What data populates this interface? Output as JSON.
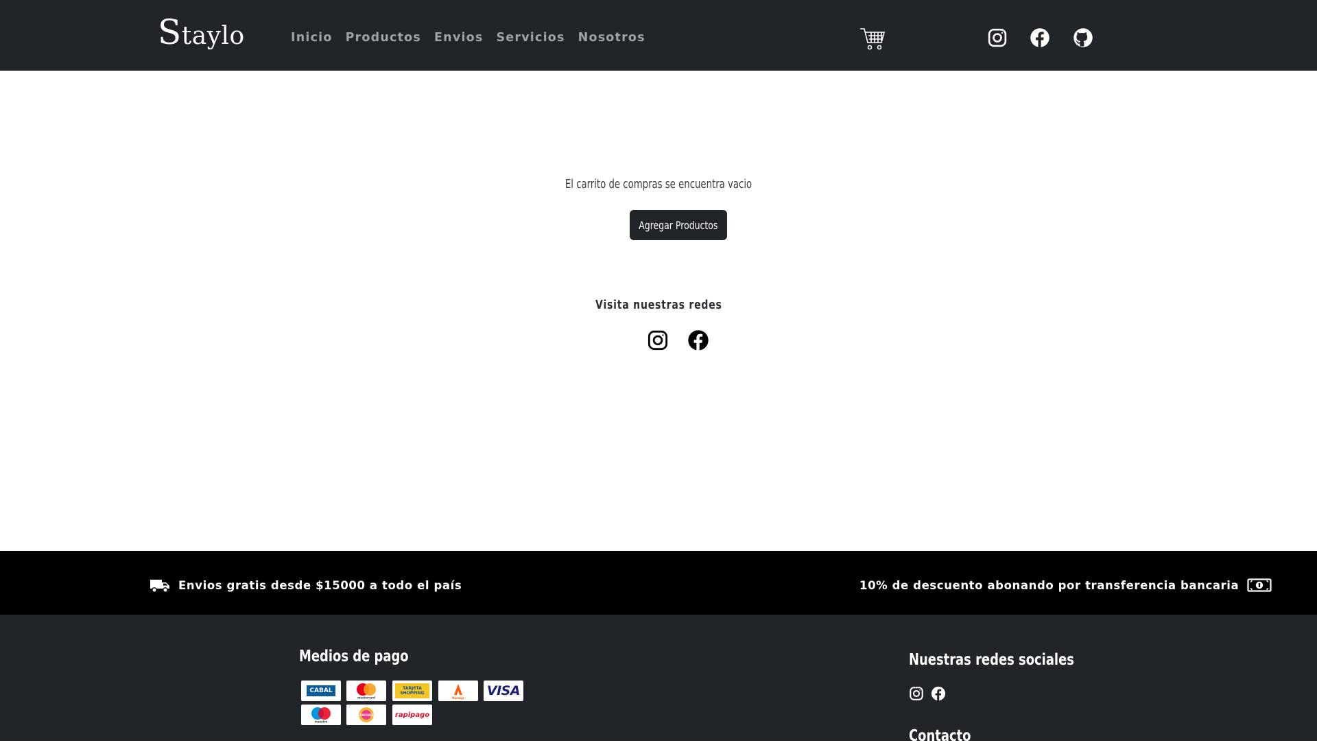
{
  "brand": {
    "first": "S",
    "rest": "taylo"
  },
  "nav": {
    "links": [
      "Inicio",
      "Productos",
      "Envios",
      "Servicios",
      "Nosotros"
    ]
  },
  "icons": {
    "cart": "cart-icon",
    "instagram": "instagram-icon",
    "facebook": "facebook-icon",
    "github": "github-icon",
    "truck": "truck-icon",
    "money": "money-icon"
  },
  "cart": {
    "empty_message": "El carrito de compras se encuentra vacio",
    "add_button": "Agregar Productos"
  },
  "social_section": {
    "title": "Visita nuestras redes"
  },
  "promo": {
    "shipping": "Envios gratis desde $15000 a todo el país",
    "discount": "10% de descuento abonando por transferencia bancaria"
  },
  "footer": {
    "payment_title": "Medios de pago",
    "social_title": "Nuestras redes sociales",
    "contact_title": "Contacto",
    "payment_methods": [
      "CABAL",
      "mastercard",
      "TARJETA SHOPPING",
      "Naranja",
      "VISA",
      "maestro",
      "CENCOSUD",
      "rapipago"
    ]
  },
  "colors": {
    "navbar": "#212529",
    "promo_bar": "#000000",
    "footer": "#212529",
    "nav_link": "#9ea3a8"
  }
}
